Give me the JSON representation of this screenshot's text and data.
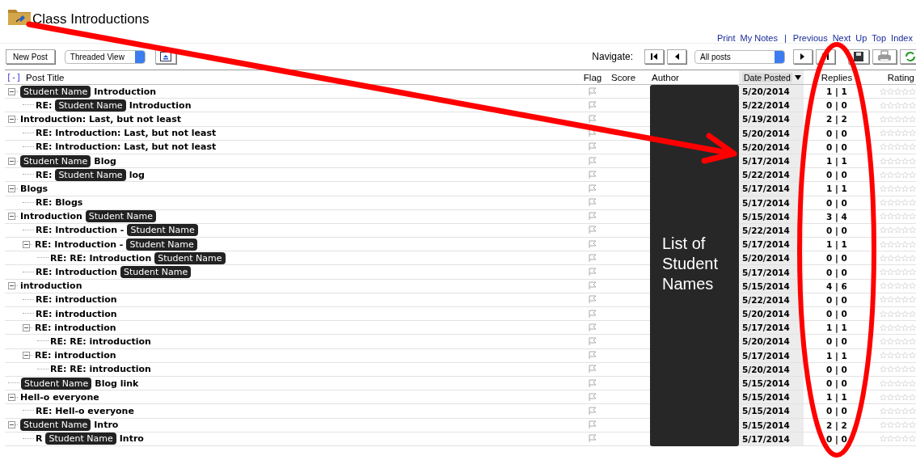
{
  "header": {
    "title": "Class Introductions"
  },
  "links": [
    {
      "kind": "link",
      "label": "Print"
    },
    {
      "kind": "link",
      "label": "My Notes"
    },
    {
      "kind": "separator",
      "label": "|"
    },
    {
      "kind": "link",
      "label": "Previous"
    },
    {
      "kind": "link",
      "label": "Next"
    },
    {
      "kind": "link",
      "label": "Up"
    },
    {
      "kind": "link",
      "label": "Top"
    },
    {
      "kind": "link",
      "label": "Index"
    }
  ],
  "toolbar": {
    "new_post": "New Post",
    "view_select": "Threaded View",
    "navigate_label": "Navigate:",
    "filter_select": "All posts"
  },
  "table": {
    "collapse_all": "[-]",
    "columns": [
      {
        "label": "Post Title",
        "sorted": false
      },
      {
        "label": "Flag",
        "sorted": false
      },
      {
        "label": "Score",
        "sorted": false
      },
      {
        "label": "Author",
        "sorted": false
      },
      {
        "label": "Date Posted",
        "sorted": true
      },
      {
        "label": "Replies",
        "sorted": false
      },
      {
        "label": "Rating",
        "sorted": false
      }
    ],
    "rows": [
      {
        "title": [
          {
            "kind": "tag",
            "text": "Student Name"
          },
          {
            "kind": "text",
            "text": "Introduction"
          }
        ],
        "date": "5/20/2014",
        "replies": "1 | 1",
        "stars": 0,
        "expanded": true,
        "children": [
          {
            "title": [
              {
                "kind": "text",
                "text": "RE:"
              },
              {
                "kind": "tag",
                "text": "Student Name"
              },
              {
                "kind": "text",
                "text": "Introduction"
              }
            ],
            "date": "5/22/2014",
            "replies": "0 | 0",
            "stars": 0
          }
        ]
      },
      {
        "title": [
          {
            "kind": "text",
            "text": "Introduction: Last, but not least"
          }
        ],
        "date": "5/19/2014",
        "replies": "2 | 2",
        "stars": 0,
        "expanded": true,
        "children": [
          {
            "title": [
              {
                "kind": "text",
                "text": "RE: Introduction: Last, but not least"
              }
            ],
            "date": "5/20/2014",
            "replies": "0 | 0",
            "stars": 0
          },
          {
            "title": [
              {
                "kind": "text",
                "text": "RE: Introduction: Last, but not least"
              }
            ],
            "date": "5/20/2014",
            "replies": "0 | 0",
            "stars": 0
          }
        ]
      },
      {
        "title": [
          {
            "kind": "tag",
            "text": "Student Name"
          },
          {
            "kind": "text",
            "text": "Blog"
          }
        ],
        "date": "5/17/2014",
        "replies": "1 | 1",
        "stars": 0,
        "expanded": true,
        "children": [
          {
            "title": [
              {
                "kind": "text",
                "text": "RE:"
              },
              {
                "kind": "tag",
                "text": "Student Name"
              },
              {
                "kind": "text",
                "text": "log"
              }
            ],
            "date": "5/22/2014",
            "replies": "0 | 0",
            "stars": 0
          }
        ]
      },
      {
        "title": [
          {
            "kind": "text",
            "text": "Blogs"
          }
        ],
        "date": "5/17/2014",
        "replies": "1 | 1",
        "stars": 0,
        "expanded": true,
        "children": [
          {
            "title": [
              {
                "kind": "text",
                "text": "RE: Blogs"
              }
            ],
            "date": "5/17/2014",
            "replies": "0 | 0",
            "stars": 0
          }
        ]
      },
      {
        "title": [
          {
            "kind": "text",
            "text": "Introduction"
          },
          {
            "kind": "tag",
            "text": "Student Name"
          }
        ],
        "date": "5/15/2014",
        "replies": "3 | 4",
        "stars": 0,
        "expanded": true,
        "children": [
          {
            "title": [
              {
                "kind": "text",
                "text": "RE: Introduction -"
              },
              {
                "kind": "tag",
                "text": "Student Name"
              }
            ],
            "date": "5/22/2014",
            "replies": "0 | 0",
            "stars": 0
          },
          {
            "title": [
              {
                "kind": "text",
                "text": "RE: Introduction -"
              },
              {
                "kind": "tag",
                "text": "Student Name"
              }
            ],
            "date": "5/17/2014",
            "replies": "1 | 1",
            "stars": 0,
            "expanded": true,
            "children": [
              {
                "title": [
                  {
                    "kind": "text",
                    "text": "RE: RE: Introduction"
                  },
                  {
                    "kind": "tag",
                    "text": "Student Name"
                  }
                ],
                "date": "5/20/2014",
                "replies": "0 | 0",
                "stars": 0
              }
            ]
          },
          {
            "title": [
              {
                "kind": "text",
                "text": "RE: Introduction"
              },
              {
                "kind": "tag",
                "text": "Student Name"
              }
            ],
            "date": "5/17/2014",
            "replies": "0 | 0",
            "stars": 0
          }
        ]
      },
      {
        "title": [
          {
            "kind": "text",
            "text": "introduction"
          }
        ],
        "date": "5/15/2014",
        "replies": "4 | 6",
        "stars": 0,
        "expanded": true,
        "children": [
          {
            "title": [
              {
                "kind": "text",
                "text": "RE: introduction"
              }
            ],
            "date": "5/22/2014",
            "replies": "0 | 0",
            "stars": 0
          },
          {
            "title": [
              {
                "kind": "text",
                "text": "RE: introduction"
              }
            ],
            "date": "5/20/2014",
            "replies": "0 | 0",
            "stars": 0
          },
          {
            "title": [
              {
                "kind": "text",
                "text": "RE: introduction"
              }
            ],
            "date": "5/17/2014",
            "replies": "1 | 1",
            "stars": 0,
            "expanded": true,
            "children": [
              {
                "title": [
                  {
                    "kind": "text",
                    "text": "RE: RE: introduction"
                  }
                ],
                "date": "5/20/2014",
                "replies": "0 | 0",
                "stars": 0
              }
            ]
          },
          {
            "title": [
              {
                "kind": "text",
                "text": "RE: introduction"
              }
            ],
            "date": "5/17/2014",
            "replies": "1 | 1",
            "stars": 0,
            "expanded": true,
            "children": [
              {
                "title": [
                  {
                    "kind": "text",
                    "text": "RE: RE: introduction"
                  }
                ],
                "date": "5/20/2014",
                "replies": "0 | 0",
                "stars": 0
              }
            ]
          }
        ]
      },
      {
        "title": [
          {
            "kind": "tag",
            "text": "Student Name"
          },
          {
            "kind": "text",
            "text": "Blog link"
          }
        ],
        "date": "5/15/2014",
        "replies": "0 | 0",
        "stars": 0
      },
      {
        "title": [
          {
            "kind": "text",
            "text": "Hell-o everyone"
          }
        ],
        "date": "5/15/2014",
        "replies": "1 | 1",
        "stars": 0,
        "expanded": true,
        "children": [
          {
            "title": [
              {
                "kind": "text",
                "text": "RE: Hell-o everyone"
              }
            ],
            "date": "5/15/2014",
            "replies": "0 | 0",
            "stars": 0
          }
        ]
      },
      {
        "title": [
          {
            "kind": "tag",
            "text": "Student Name"
          },
          {
            "kind": "text",
            "text": "Intro"
          }
        ],
        "date": "5/15/2014",
        "replies": "2 | 2",
        "stars": 0,
        "expanded": true,
        "children": [
          {
            "title": [
              {
                "kind": "text",
                "text": "R"
              },
              {
                "kind": "tag",
                "text": "Student Name"
              },
              {
                "kind": "text",
                "text": "Intro"
              }
            ],
            "date": "5/17/2014",
            "replies": "0 | 0",
            "stars": 0
          }
        ]
      }
    ]
  },
  "author_overlay": "List of Student Names"
}
